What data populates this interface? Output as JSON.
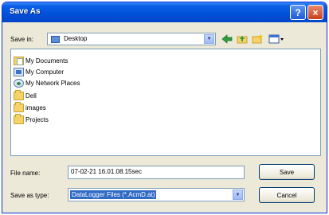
{
  "window": {
    "title": "Save As"
  },
  "titlebar": {
    "help_label": "?",
    "close_label": "×"
  },
  "save_in": {
    "label": "Save in:",
    "value": "Desktop",
    "arrow": "▼"
  },
  "toolbar": {
    "icons": [
      "back-icon",
      "up-folder-icon",
      "new-folder-icon",
      "views-icon"
    ]
  },
  "file_list": {
    "items": [
      {
        "label": "My Documents",
        "icon": "my-documents-icon"
      },
      {
        "label": "My Computer",
        "icon": "my-computer-icon"
      },
      {
        "label": "My Network Places",
        "icon": "network-places-icon"
      },
      {
        "label": "Dell",
        "icon": "folder-icon"
      },
      {
        "label": "images",
        "icon": "folder-icon"
      },
      {
        "label": "Projects",
        "icon": "folder-icon"
      }
    ]
  },
  "file_name": {
    "label": "File name:",
    "value": "07-02-21 16.01.08.15sec"
  },
  "save_as_type": {
    "label": "Save as type:",
    "value": "DataLogger Files (*.AcmD.at)",
    "arrow": "▼"
  },
  "buttons": {
    "save": "Save",
    "cancel": "Cancel"
  },
  "colors": {
    "titlebar": "#0050d8",
    "selection": "#316ac5",
    "dialog_bg": "#ece9d8"
  }
}
